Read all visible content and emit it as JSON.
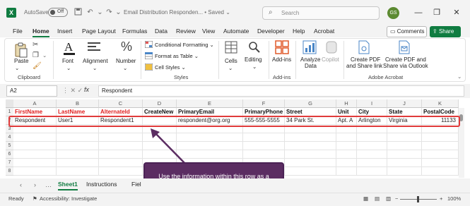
{
  "titlebar": {
    "app_letter": "X",
    "autosave_label": "AutoSave",
    "autosave_state": "Off",
    "doc_title": "Email Distribution Responden... • Saved ⌄",
    "search_placeholder": "Search",
    "avatar_initials": "GS",
    "minimize": "—",
    "restore": "❐",
    "close": "✕"
  },
  "menu": {
    "items": [
      "File",
      "Home",
      "Insert",
      "Page Layout",
      "Formulas",
      "Data",
      "Review",
      "View",
      "Automate",
      "Developer",
      "Help",
      "Acrobat"
    ],
    "active": "Home",
    "comments_label": "Comments",
    "share_label": "Share"
  },
  "ribbon": {
    "clipboard": {
      "paste": "Paste",
      "group": "Clipboard"
    },
    "font": {
      "label": "Font"
    },
    "alignment": {
      "label": "Alignment"
    },
    "number": {
      "label": "Number"
    },
    "styles": {
      "conditional": "Conditional Formatting ⌄",
      "format_table": "Format as Table ⌄",
      "cell_styles": "Cell Styles ⌄",
      "group": "Styles"
    },
    "cells": {
      "label": "Cells"
    },
    "editing": {
      "label": "Editing"
    },
    "addins": {
      "label": "Add-ins",
      "group": "Add-ins"
    },
    "analyze": {
      "line1": "Analyze",
      "line2": "Data"
    },
    "copilot": {
      "label": "Copilot"
    },
    "acrobat": {
      "pdf1_line1": "Create PDF",
      "pdf1_line2": "and Share link",
      "pdf2_line1": "Create PDF and",
      "pdf2_line2": "Share via Outlook",
      "group": "Adobe Acrobat"
    }
  },
  "formula_bar": {
    "name_box": "A2",
    "fx": "fx",
    "value": "Respondent"
  },
  "sheet": {
    "columns": [
      "A",
      "B",
      "C",
      "D",
      "E",
      "F",
      "G",
      "H",
      "I",
      "J",
      "K"
    ],
    "rows": [
      "1",
      "2",
      "3",
      "4",
      "5",
      "6",
      "7",
      "8"
    ],
    "header_row": [
      "FirstName",
      "LastName",
      "AlternateId",
      "CreateNew",
      "PrimaryEmail",
      "PrimaryPhone",
      "Street",
      "Unit",
      "City",
      "State",
      "PostalCode"
    ],
    "data_row": [
      "Respondent",
      "User1",
      "Respondent1",
      "",
      "respondent@org.org",
      "555-555-5555",
      "34 Park St.",
      "Apt. A",
      "Arlington",
      "Virginia",
      "11133"
    ]
  },
  "callout": {
    "text": "Use the information within this row as a reference for format to be used"
  },
  "tabs": {
    "items": [
      "Sheet1",
      "Instructions",
      "Fiel"
    ],
    "active": "Sheet1"
  },
  "status": {
    "ready": "Ready",
    "accessibility": "Accessibility: Investigate",
    "zoom_minus": "−",
    "zoom_plus": "+",
    "zoom": "100%"
  },
  "colors": {
    "accent": "#107c41",
    "highlight": "#e03b3b",
    "callout": "#5b2d62",
    "header_red": "#e02020"
  }
}
